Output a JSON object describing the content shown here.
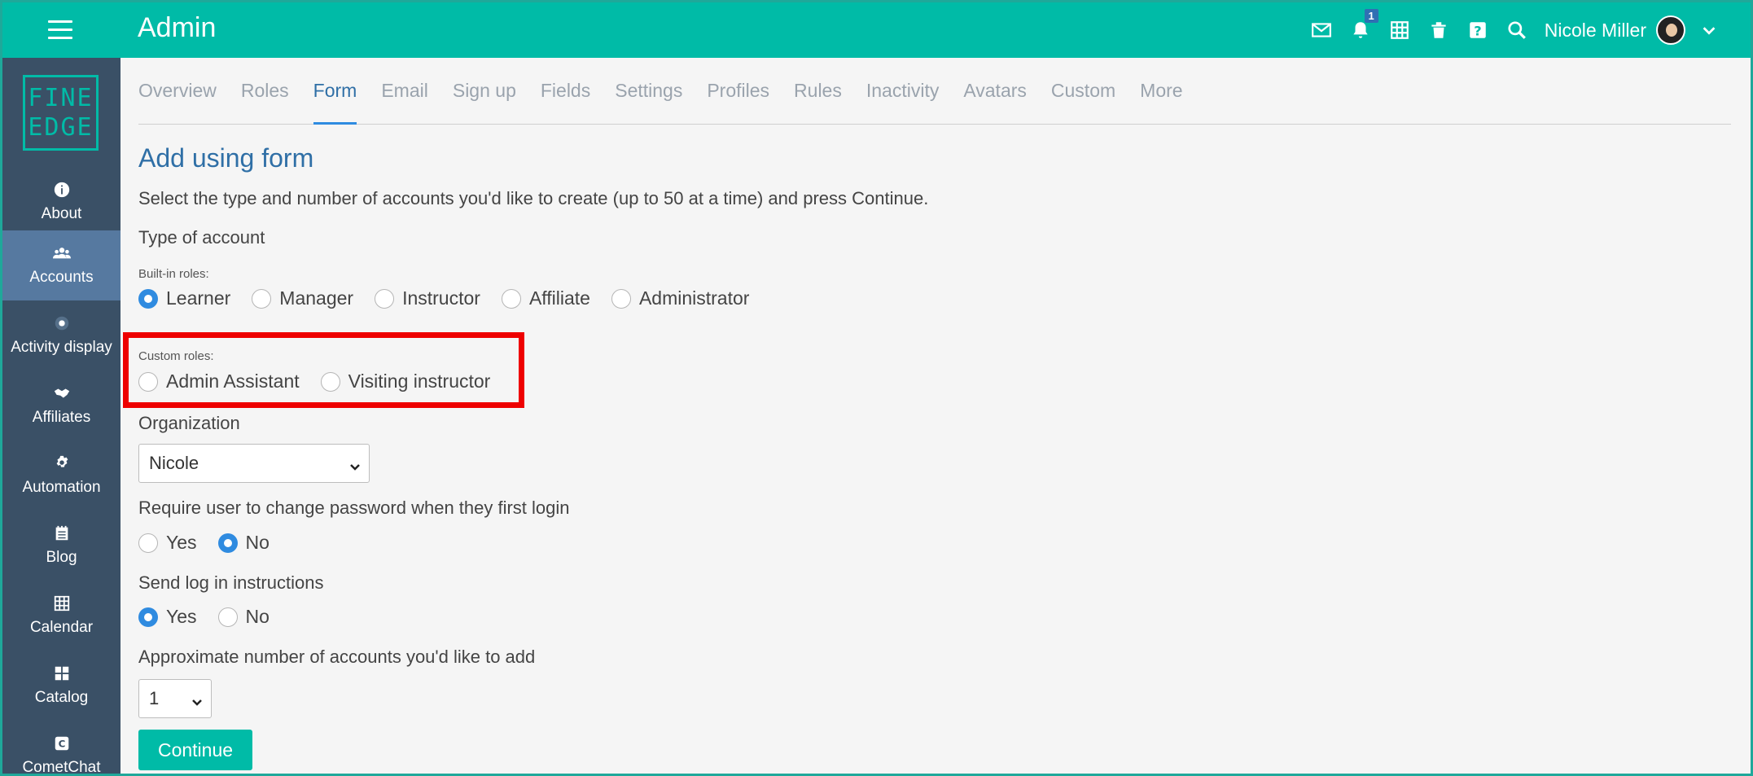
{
  "app": {
    "title": "Admin"
  },
  "topbar": {
    "notification_count": "1",
    "user_name": "Nicole Miller",
    "icons": [
      "menu-icon",
      "mail-icon",
      "bell-icon",
      "grid-icon",
      "trash-icon",
      "help-icon",
      "search-icon",
      "chevron-down-icon"
    ]
  },
  "logo": {
    "line1": "FINE",
    "line2": "EDGE"
  },
  "sidebar": {
    "items": [
      {
        "label": "About",
        "icon": "info-icon"
      },
      {
        "label": "Accounts",
        "icon": "users-icon",
        "active": true
      },
      {
        "label": "Activity display",
        "icon": "dot-icon"
      },
      {
        "label": "Affiliates",
        "icon": "handshake-icon"
      },
      {
        "label": "Automation",
        "icon": "gear-icon"
      },
      {
        "label": "Blog",
        "icon": "blog-icon"
      },
      {
        "label": "Calendar",
        "icon": "calendar-icon"
      },
      {
        "label": "Catalog",
        "icon": "catalog-icon"
      },
      {
        "label": "CometChat",
        "icon": "chat-icon"
      }
    ]
  },
  "tabs": [
    {
      "label": "Overview"
    },
    {
      "label": "Roles"
    },
    {
      "label": "Form",
      "active": true
    },
    {
      "label": "Email"
    },
    {
      "label": "Sign up"
    },
    {
      "label": "Fields"
    },
    {
      "label": "Settings"
    },
    {
      "label": "Profiles"
    },
    {
      "label": "Rules"
    },
    {
      "label": "Inactivity"
    },
    {
      "label": "Avatars"
    },
    {
      "label": "Custom"
    },
    {
      "label": "More"
    }
  ],
  "form": {
    "heading": "Add using form",
    "instructions": "Select the type and number of accounts you'd like to create (up to 50 at a time) and press Continue.",
    "type_label": "Type of account",
    "builtin_label": "Built-in roles:",
    "builtin_roles": [
      {
        "label": "Learner",
        "checked": true
      },
      {
        "label": "Manager"
      },
      {
        "label": "Instructor"
      },
      {
        "label": "Affiliate"
      },
      {
        "label": "Administrator"
      }
    ],
    "custom_label": "Custom roles:",
    "custom_roles": [
      {
        "label": "Admin Assistant"
      },
      {
        "label": "Visiting instructor"
      }
    ],
    "organization_label": "Organization",
    "organization_value": "Nicole",
    "password_label": "Require user to change password when they first login",
    "password_options": [
      {
        "label": "Yes"
      },
      {
        "label": "No",
        "checked": true
      }
    ],
    "instructions_label": "Send log in instructions",
    "instructions_options": [
      {
        "label": "Yes",
        "checked": true
      },
      {
        "label": "No"
      }
    ],
    "count_label": "Approximate number of accounts you'd like to add",
    "count_value": "1",
    "continue_label": "Continue"
  },
  "colors": {
    "accent": "#00bba7",
    "sidebar": "#3a5066",
    "link": "#2f6fa6",
    "radio": "#2f8be0",
    "highlight": "#ee0000"
  }
}
